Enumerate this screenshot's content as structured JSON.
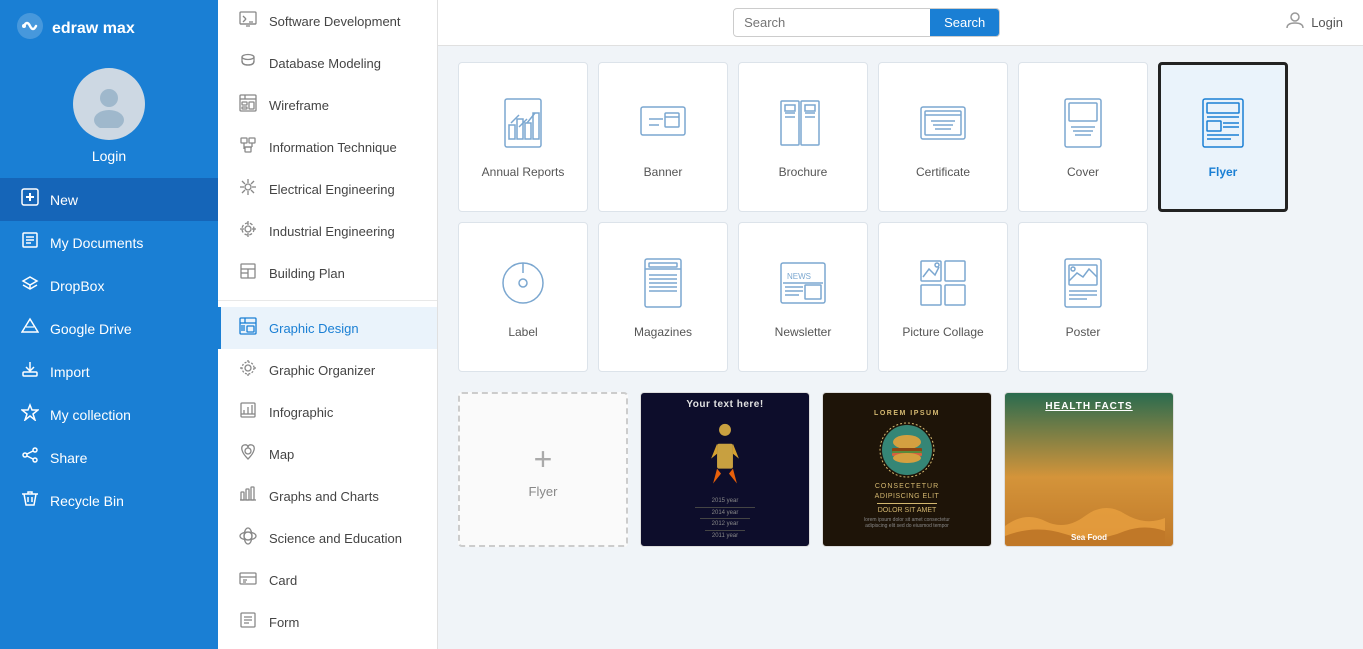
{
  "app": {
    "logo_text": "edraw max",
    "login_label": "Login"
  },
  "sidebar": {
    "items": [
      {
        "id": "new",
        "label": "New",
        "icon": "➕",
        "active": true
      },
      {
        "id": "my-documents",
        "label": "My Documents",
        "icon": "📄"
      },
      {
        "id": "dropbox",
        "label": "DropBox",
        "icon": "📦"
      },
      {
        "id": "google-drive",
        "label": "Google Drive",
        "icon": "🔺"
      },
      {
        "id": "import",
        "label": "Import",
        "icon": "📥"
      },
      {
        "id": "my-collection",
        "label": "My collection",
        "icon": "⭐"
      },
      {
        "id": "share",
        "label": "Share",
        "icon": "🔗"
      },
      {
        "id": "recycle-bin",
        "label": "Recycle Bin",
        "icon": "🗑️"
      }
    ]
  },
  "mid_nav": {
    "sections": [
      {
        "items": [
          {
            "id": "software-development",
            "label": "Software Development",
            "icon": "grid"
          },
          {
            "id": "database-modeling",
            "label": "Database Modeling",
            "icon": "database"
          },
          {
            "id": "wireframe",
            "label": "Wireframe",
            "icon": "wireframe"
          },
          {
            "id": "information-technique",
            "label": "Information Technique",
            "icon": "info"
          },
          {
            "id": "electrical-engineering",
            "label": "Electrical Engineering",
            "icon": "electrical"
          },
          {
            "id": "industrial-engineering",
            "label": "Industrial Engineering",
            "icon": "industrial"
          },
          {
            "id": "building-plan",
            "label": "Building Plan",
            "icon": "building"
          }
        ]
      },
      {
        "items": [
          {
            "id": "graphic-design",
            "label": "Graphic Design",
            "icon": "graphic",
            "active": true
          },
          {
            "id": "graphic-organizer",
            "label": "Graphic Organizer",
            "icon": "organizer"
          },
          {
            "id": "infographic",
            "label": "Infographic",
            "icon": "infographic"
          },
          {
            "id": "map",
            "label": "Map",
            "icon": "map"
          },
          {
            "id": "graphs-charts",
            "label": "Graphs and Charts",
            "icon": "charts"
          },
          {
            "id": "science-education",
            "label": "Science and Education",
            "icon": "science"
          },
          {
            "id": "card",
            "label": "Card",
            "icon": "card"
          },
          {
            "id": "form",
            "label": "Form",
            "icon": "form"
          }
        ]
      }
    ]
  },
  "header": {
    "search_placeholder": "Search",
    "search_button": "Search",
    "login_label": "Login"
  },
  "template_cards": [
    {
      "id": "annual-reports",
      "label": "Annual Reports",
      "selected": false
    },
    {
      "id": "banner",
      "label": "Banner",
      "selected": false
    },
    {
      "id": "brochure",
      "label": "Brochure",
      "selected": false
    },
    {
      "id": "certificate",
      "label": "Certificate",
      "selected": false
    },
    {
      "id": "cover",
      "label": "Cover",
      "selected": false
    },
    {
      "id": "flyer",
      "label": "Flyer",
      "selected": true
    },
    {
      "id": "label",
      "label": "Label",
      "selected": false
    },
    {
      "id": "magazines",
      "label": "Magazines",
      "selected": false
    },
    {
      "id": "newsletter",
      "label": "Newsletter",
      "selected": false
    },
    {
      "id": "picture-collage",
      "label": "Picture Collage",
      "selected": false
    },
    {
      "id": "poster",
      "label": "Poster",
      "selected": false
    }
  ],
  "preview_section": {
    "blank_label": "Flyer",
    "templates": [
      {
        "id": "space-flyer",
        "type": "space"
      },
      {
        "id": "burger-flyer",
        "type": "burger"
      }
    ]
  },
  "preview_section2": {
    "templates": [
      {
        "id": "health-flyer",
        "type": "health"
      }
    ]
  }
}
